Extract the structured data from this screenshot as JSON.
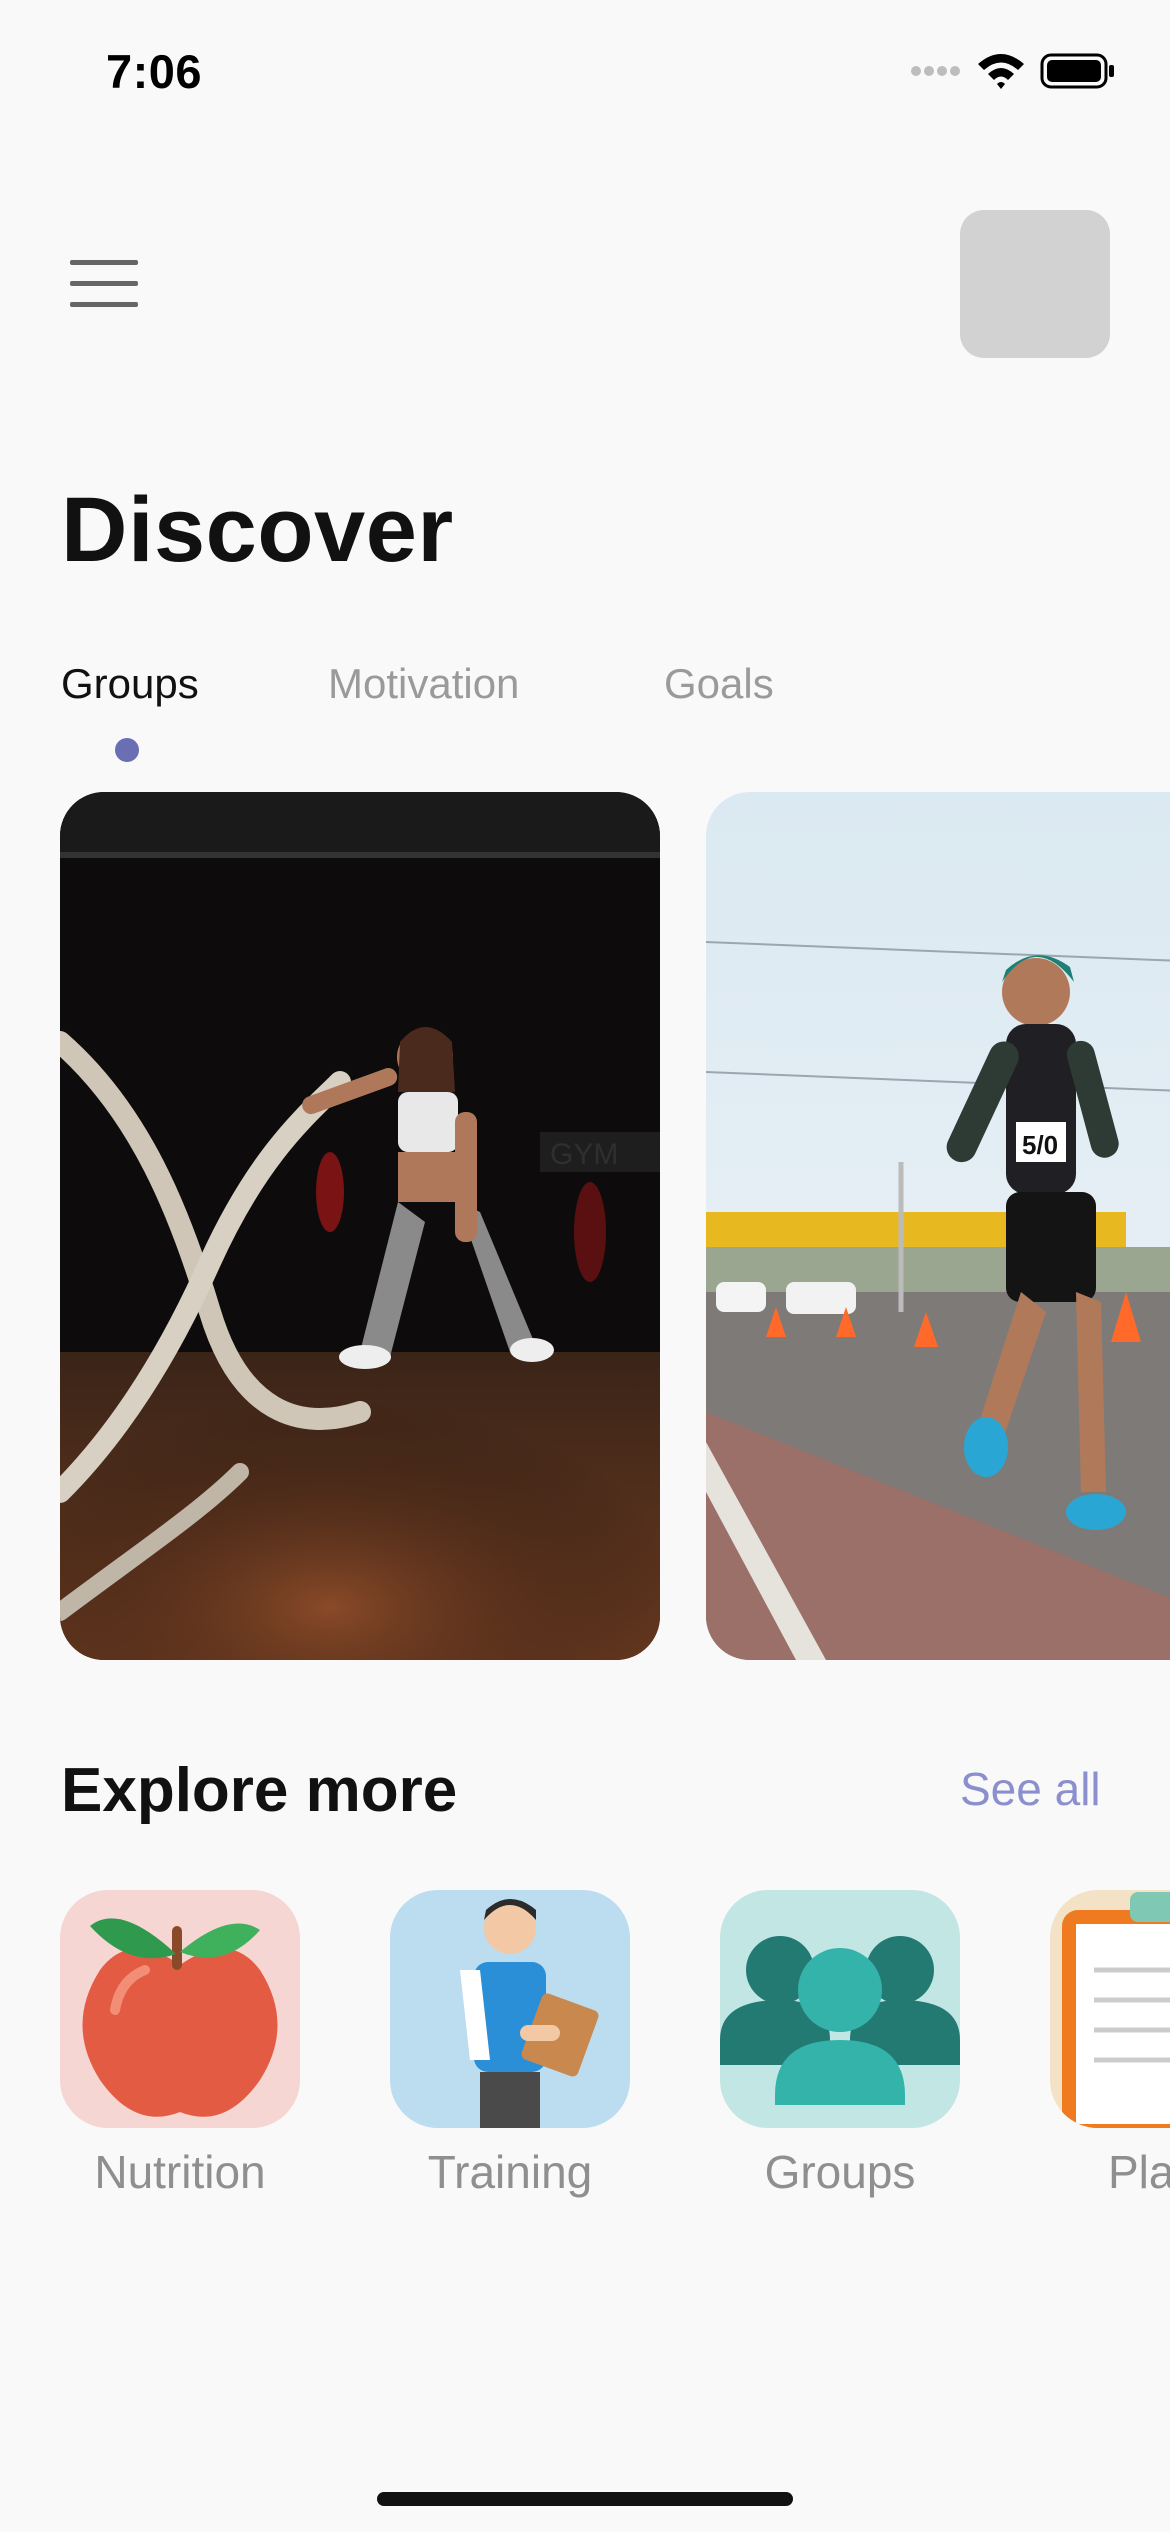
{
  "status_bar": {
    "time": "7:06"
  },
  "header": {
    "title": "Discover"
  },
  "tabs": [
    {
      "label": "Groups",
      "active": true
    },
    {
      "label": "Motivation",
      "active": false
    },
    {
      "label": "Goals",
      "active": false
    }
  ],
  "cards": [
    {
      "icon": "battle-ropes-photo",
      "bib": ""
    },
    {
      "icon": "runner-photo",
      "bib": "5/0"
    }
  ],
  "explore": {
    "title": "Explore more",
    "see_all": "See all",
    "items": [
      {
        "label": "Nutrition",
        "icon": "apple-icon"
      },
      {
        "label": "Training",
        "icon": "trainer-icon"
      },
      {
        "label": "Groups",
        "icon": "group-icon"
      },
      {
        "label": "Pla",
        "icon": "clipboard-icon"
      }
    ]
  },
  "colors": {
    "accent": "#6a6fb4",
    "link": "#8c8fcd",
    "background": "#f9f9f9"
  }
}
